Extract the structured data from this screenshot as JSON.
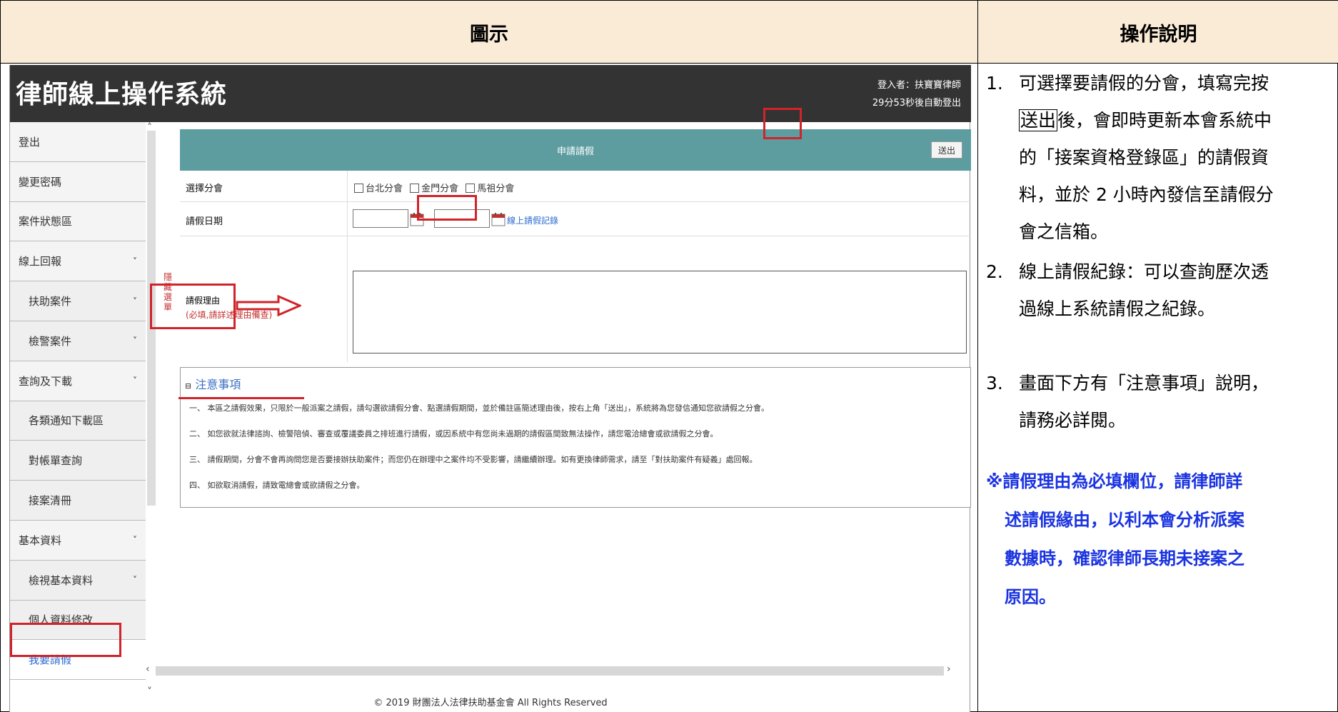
{
  "table": {
    "header_left": "圖示",
    "header_right": "操作說明"
  },
  "app": {
    "title": "律師線上操作系統",
    "user_line1": "登入者：扶寶寶律師",
    "user_line2": "29分53秒後自動登出",
    "hide_menu": "隱藏選單",
    "footer": "© 2019 財團法人法律扶助基金會 All Rights Reserved"
  },
  "sidebar": {
    "items": [
      {
        "label": "登出",
        "chevron": "",
        "sub": false
      },
      {
        "label": "變更密碼",
        "chevron": "",
        "sub": false
      },
      {
        "label": "案件狀態區",
        "chevron": "",
        "sub": false
      },
      {
        "label": "線上回報",
        "chevron": "˅",
        "sub": false
      },
      {
        "label": "扶助案件",
        "chevron": "˅",
        "sub": true
      },
      {
        "label": "檢警案件",
        "chevron": "˅",
        "sub": true
      },
      {
        "label": "查詢及下載",
        "chevron": "˅",
        "sub": false
      },
      {
        "label": "各類通知下載區",
        "chevron": "",
        "sub": true
      },
      {
        "label": "對帳單查詢",
        "chevron": "",
        "sub": true
      },
      {
        "label": "接案清冊",
        "chevron": "",
        "sub": true
      },
      {
        "label": "基本資料",
        "chevron": "˅",
        "sub": false
      },
      {
        "label": "檢視基本資料",
        "chevron": "˅",
        "sub": true
      },
      {
        "label": "個人資料修改",
        "chevron": "",
        "sub": true
      },
      {
        "label": "我要請假",
        "chevron": "",
        "sub": true
      }
    ]
  },
  "form": {
    "bar_title": "申請請假",
    "send_button": "送出",
    "branch_label": "選擇分會",
    "branches": [
      "台北分會",
      "金門分會",
      "馬祖分會"
    ],
    "date_label": "請假日期",
    "date_sep": "~",
    "leave_record_link": "線上請假記錄",
    "reason_label": "請假理由",
    "reason_required": "(必填,請詳述理由備查)"
  },
  "notes": {
    "title": "注意事項",
    "lines": [
      {
        "num": "一、",
        "underlined": "本區之請假效果，只限於一般派案之請假",
        "rest": "，請勾選欲請假分會、點選請假期間，並於備註區簡述理由後，按右上角「送出」，系統將為您發信通知您欲請假之分會。"
      },
      {
        "num": "二、",
        "underlined": "",
        "rest": "如您欲就法律諮詢、檢警陪偵、審查或覆議委員之排班進行請假，或因系統中有您尚未過期的請假區間致無法操作，請您電洽總會或欲請假之分會。"
      },
      {
        "num": "三、",
        "underlined": "",
        "rest": "請假期間，分會不會再詢問您是否要接辦扶助案件；而您仍在辦理中之案件均不受影響，請繼續辦理。如有更換律師需求，請至「對扶助案件有疑義」處回報。"
      },
      {
        "num": "四、",
        "underlined": "",
        "rest": "如欲取消請假，請致電總會或欲請假之分會。"
      }
    ]
  },
  "instructions": {
    "item1_num": "1.",
    "item1_l1": "可選擇要請假的分會，填寫完按",
    "item1_boxed": "送出",
    "item1_l2": "後，會即時更新本會系統中",
    "item1_l3": "的「接案資格登錄區」的請假資",
    "item1_l4": "料，並於 2 小時內發信至請假分",
    "item1_l5": "會之信箱。",
    "item2_num": "2.",
    "item2_l1": "線上請假紀錄：可以查詢歷次透",
    "item2_l2": "過線上系統請假之紀錄。",
    "item3_num": "3.",
    "item3_l1": "畫面下方有「注意事項」說明，",
    "item3_l2": "請務必詳閱。",
    "note_l1": "※請假理由為必填欄位，請律師詳",
    "note_l2": "述請假緣由，以利本會分析派案",
    "note_l3": "數據時，確認律師長期未接案之",
    "note_l4": "原因。"
  },
  "colors": {
    "header_bg": "#faebd7",
    "app_header_bg": "#333334",
    "form_bar_bg": "#5d9da0",
    "highlight_red": "#d0232a",
    "note_blue": "#1a33e0",
    "link_blue": "#2a6bd1"
  }
}
